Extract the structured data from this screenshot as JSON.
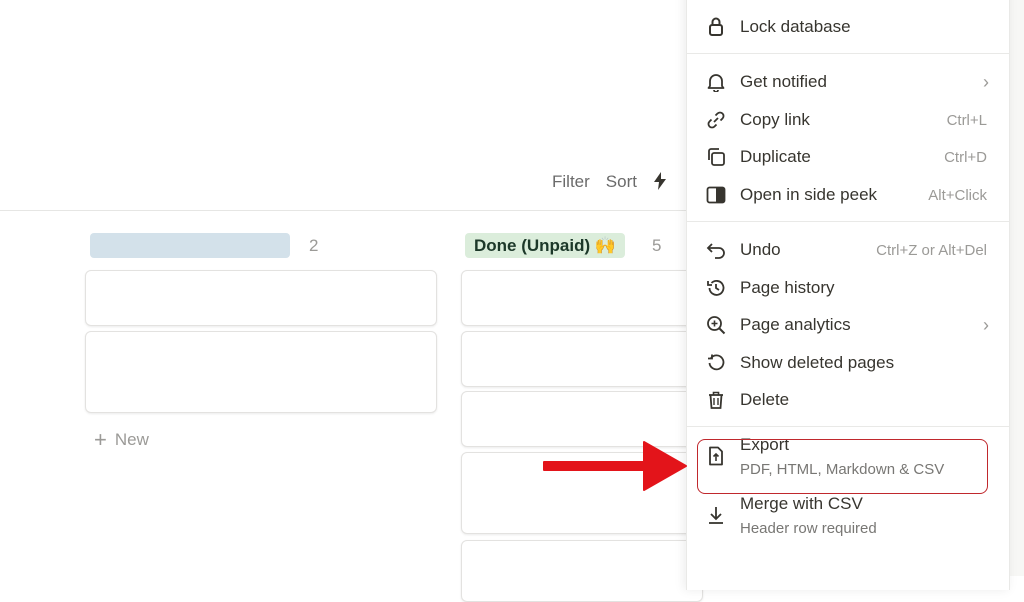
{
  "toolbar": {
    "filter": "Filter",
    "sort": "Sort"
  },
  "board": {
    "col1": {
      "count": "2"
    },
    "col2": {
      "title": "Done (Unpaid) 🙌",
      "count": "5"
    },
    "new_label": "New"
  },
  "menu": {
    "lock": {
      "label": "Lock database"
    },
    "notify": {
      "label": "Get notified"
    },
    "copy_link": {
      "label": "Copy link",
      "shortcut": "Ctrl+L"
    },
    "duplicate": {
      "label": "Duplicate",
      "shortcut": "Ctrl+D"
    },
    "side_peek": {
      "label": "Open in side peek",
      "shortcut": "Alt+Click"
    },
    "undo": {
      "label": "Undo",
      "shortcut": "Ctrl+Z or Alt+Del"
    },
    "history": {
      "label": "Page history"
    },
    "analytics": {
      "label": "Page analytics"
    },
    "deleted": {
      "label": "Show deleted pages"
    },
    "delete": {
      "label": "Delete"
    },
    "export": {
      "label": "Export",
      "sub": "PDF, HTML, Markdown & CSV"
    },
    "merge": {
      "label": "Merge with CSV",
      "sub": "Header row required"
    }
  },
  "colors": {
    "annotation_red": "#e3141a",
    "highlight_border": "#c0282d",
    "done_tag_bg": "#dbeddb",
    "status_tag_bg": "#d3e1ea"
  }
}
